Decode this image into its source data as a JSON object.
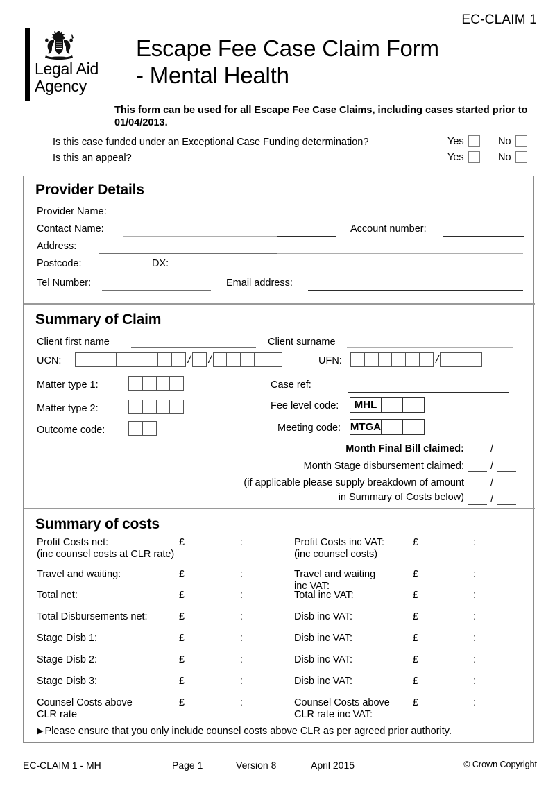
{
  "header": {
    "doc_code": "EC-CLAIM 1",
    "logo": {
      "crest_icon": "royal-coat-of-arms-icon",
      "line1": "Legal Aid",
      "line2": "Agency"
    },
    "title_line1": "Escape Fee Case Claim Form",
    "title_line2": "- Mental Health",
    "subtitle": "This form can be used for all Escape Fee Case Claims, including cases started prior to 01/04/2013.",
    "questions": [
      {
        "text": "Is this case funded under an Exceptional Case Funding determination?",
        "yes_label": "Yes",
        "no_label": "No"
      },
      {
        "text": "Is this an appeal?",
        "yes_label": "Yes",
        "no_label": "No"
      }
    ]
  },
  "provider_details": {
    "heading": "Provider Details",
    "provider_name_label": "Provider Name:",
    "contact_name_label": "Contact Name:",
    "account_number_label": "Account number:",
    "address_label": "Address:",
    "postcode_label": "Postcode:",
    "dx_label": "DX:",
    "tel_label": "Tel Number:",
    "email_label": "Email address:",
    "provider_name_value": "",
    "contact_name_value": "",
    "account_number_value": "",
    "address_value": "",
    "postcode_value": "",
    "dx_value": "",
    "tel_value": "",
    "email_value": ""
  },
  "summary_of_claim": {
    "heading": "Summary of Claim",
    "client_first_name_label": "Client first name",
    "client_surname_label": "Client surname",
    "ucn_label": "UCN:",
    "ufn_label": "UFN:",
    "ucn_groups": [
      8,
      1,
      5
    ],
    "ufn_groups": [
      6,
      3
    ],
    "matter_type_1_label": "Matter type 1:",
    "matter_type_2_label": "Matter type 2:",
    "outcome_code_label": "Outcome code:",
    "matter_type_1_boxes": 4,
    "matter_type_2_boxes": 4,
    "outcome_code_boxes": 2,
    "case_ref_label": "Case ref:",
    "fee_level_code_label": "Fee level code:",
    "fee_level_code_prefix": "MHL",
    "fee_level_code_blanks": 2,
    "meeting_code_label": "Meeting code:",
    "meeting_code_prefix": "MTGA",
    "meeting_code_blanks": 2,
    "month_rows": [
      {
        "label": "Month Final Bill claimed:",
        "bold": true
      },
      {
        "label": "Month Stage disbursement claimed:",
        "bold": false
      },
      {
        "label": "(if applicable please supply breakdown of amount",
        "bold": false
      },
      {
        "label": "in Summary of Costs below)",
        "bold": false
      }
    ],
    "date_separator": "/"
  },
  "summary_of_costs": {
    "heading": "Summary of costs",
    "currency_symbol": "£",
    "colon_symbol": ":",
    "rows": [
      {
        "left_label": "Profit Costs net:\n(inc counsel costs at CLR rate)",
        "right_label": "Profit Costs inc VAT:\n(inc counsel costs)"
      },
      {
        "left_label": "Travel and waiting:",
        "right_label": "Travel and waiting\ninc VAT:"
      },
      {
        "left_label": "Total net:",
        "right_label": "Total inc VAT:"
      },
      {
        "left_label": "Total Disbursements net:",
        "right_label": "Disb inc VAT:"
      },
      {
        "left_label": "Stage Disb 1:",
        "right_label": "Disb inc VAT:"
      },
      {
        "left_label": "Stage Disb 2:",
        "right_label": "Disb inc VAT:"
      },
      {
        "left_label": "Stage Disb 3:",
        "right_label": "Disb inc VAT:"
      },
      {
        "left_label": "Counsel Costs above\nCLR rate",
        "right_label": "Counsel Costs above\nCLR rate inc VAT:"
      }
    ],
    "note": "Please ensure that you only include counsel costs above CLR as per agreed prior authority."
  },
  "footer": {
    "form_id": "EC-CLAIM 1 - MH",
    "page": "Page 1",
    "version": "Version 8",
    "date": "April 2015",
    "copyright": "© Crown Copyright"
  }
}
